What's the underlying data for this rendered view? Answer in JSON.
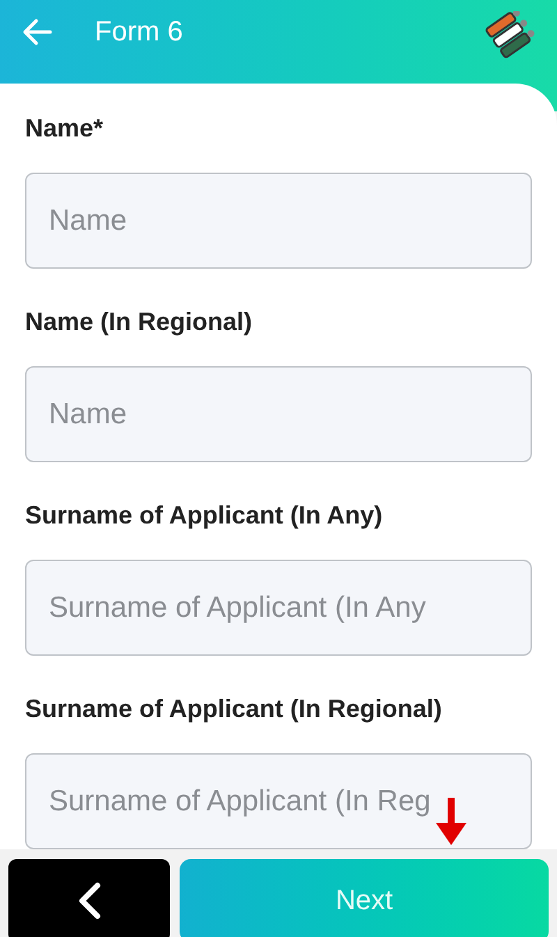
{
  "header": {
    "title": "Form 6"
  },
  "fields": [
    {
      "label": "Name*",
      "placeholder": "Name"
    },
    {
      "label": "Name (In Regional)",
      "placeholder": "Name"
    },
    {
      "label": "Surname of Applicant (In Any)",
      "placeholder": "Surname of Applicant (In Any"
    },
    {
      "label": "Surname of Applicant (In Regional)",
      "placeholder": "Surname of Applicant (In Reg"
    }
  ],
  "footer": {
    "next_button": "Next"
  }
}
